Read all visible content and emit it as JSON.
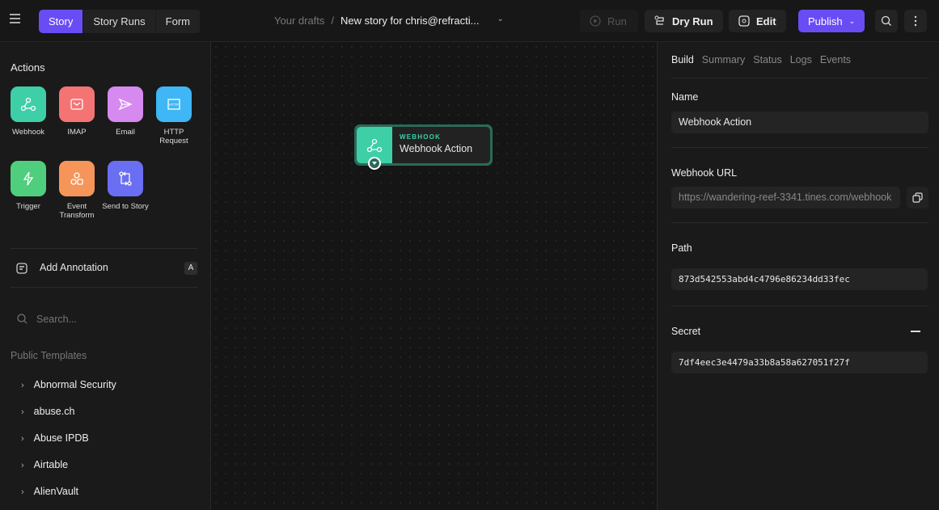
{
  "header": {
    "tabs": [
      {
        "label": "Story",
        "active": true
      },
      {
        "label": "Story Runs"
      },
      {
        "label": "Form"
      }
    ],
    "breadcrumb": {
      "parent": "Your drafts",
      "separator": "/",
      "current": "New story for chris@refracti..."
    },
    "buttons": {
      "run": "Run",
      "dry_run": "Dry Run",
      "edit": "Edit",
      "publish": "Publish"
    }
  },
  "sidebar": {
    "actions_title": "Actions",
    "actions": [
      {
        "label": "Webhook",
        "color": "#3ecfa7"
      },
      {
        "label": "IMAP",
        "color": "#f47474"
      },
      {
        "label": "Email",
        "color": "#d68af0"
      },
      {
        "label": "HTTP Request",
        "color": "#3fb6f5"
      },
      {
        "label": "Trigger",
        "color": "#4fcf7d"
      },
      {
        "label": "Event Transform",
        "color": "#f5955a"
      },
      {
        "label": "Send to Story",
        "color": "#6a6ef2"
      }
    ],
    "annotation": {
      "label": "Add Annotation",
      "shortcut": "A"
    },
    "search_placeholder": "Search...",
    "templates_title": "Public Templates",
    "templates": [
      "Abnormal Security",
      "abuse.ch",
      "Abuse IPDB",
      "Airtable",
      "AlienVault"
    ]
  },
  "canvas": {
    "node": {
      "type": "WEBHOOK",
      "name": "Webhook Action",
      "color": "#3ecfa7"
    }
  },
  "panel": {
    "tabs": [
      {
        "label": "Build",
        "active": true
      },
      {
        "label": "Summary"
      },
      {
        "label": "Status"
      },
      {
        "label": "Logs"
      },
      {
        "label": "Events"
      }
    ],
    "name_label": "Name",
    "name_value": "Webhook Action",
    "url_label": "Webhook URL",
    "url_value": "https://wandering-reef-3341.tines.com/webhook",
    "path_label": "Path",
    "path_value": "873d542553abd4c4796e86234dd33fec",
    "secret_label": "Secret",
    "secret_value": "7df4eec3e4479a33b8a58a627051f27f"
  }
}
